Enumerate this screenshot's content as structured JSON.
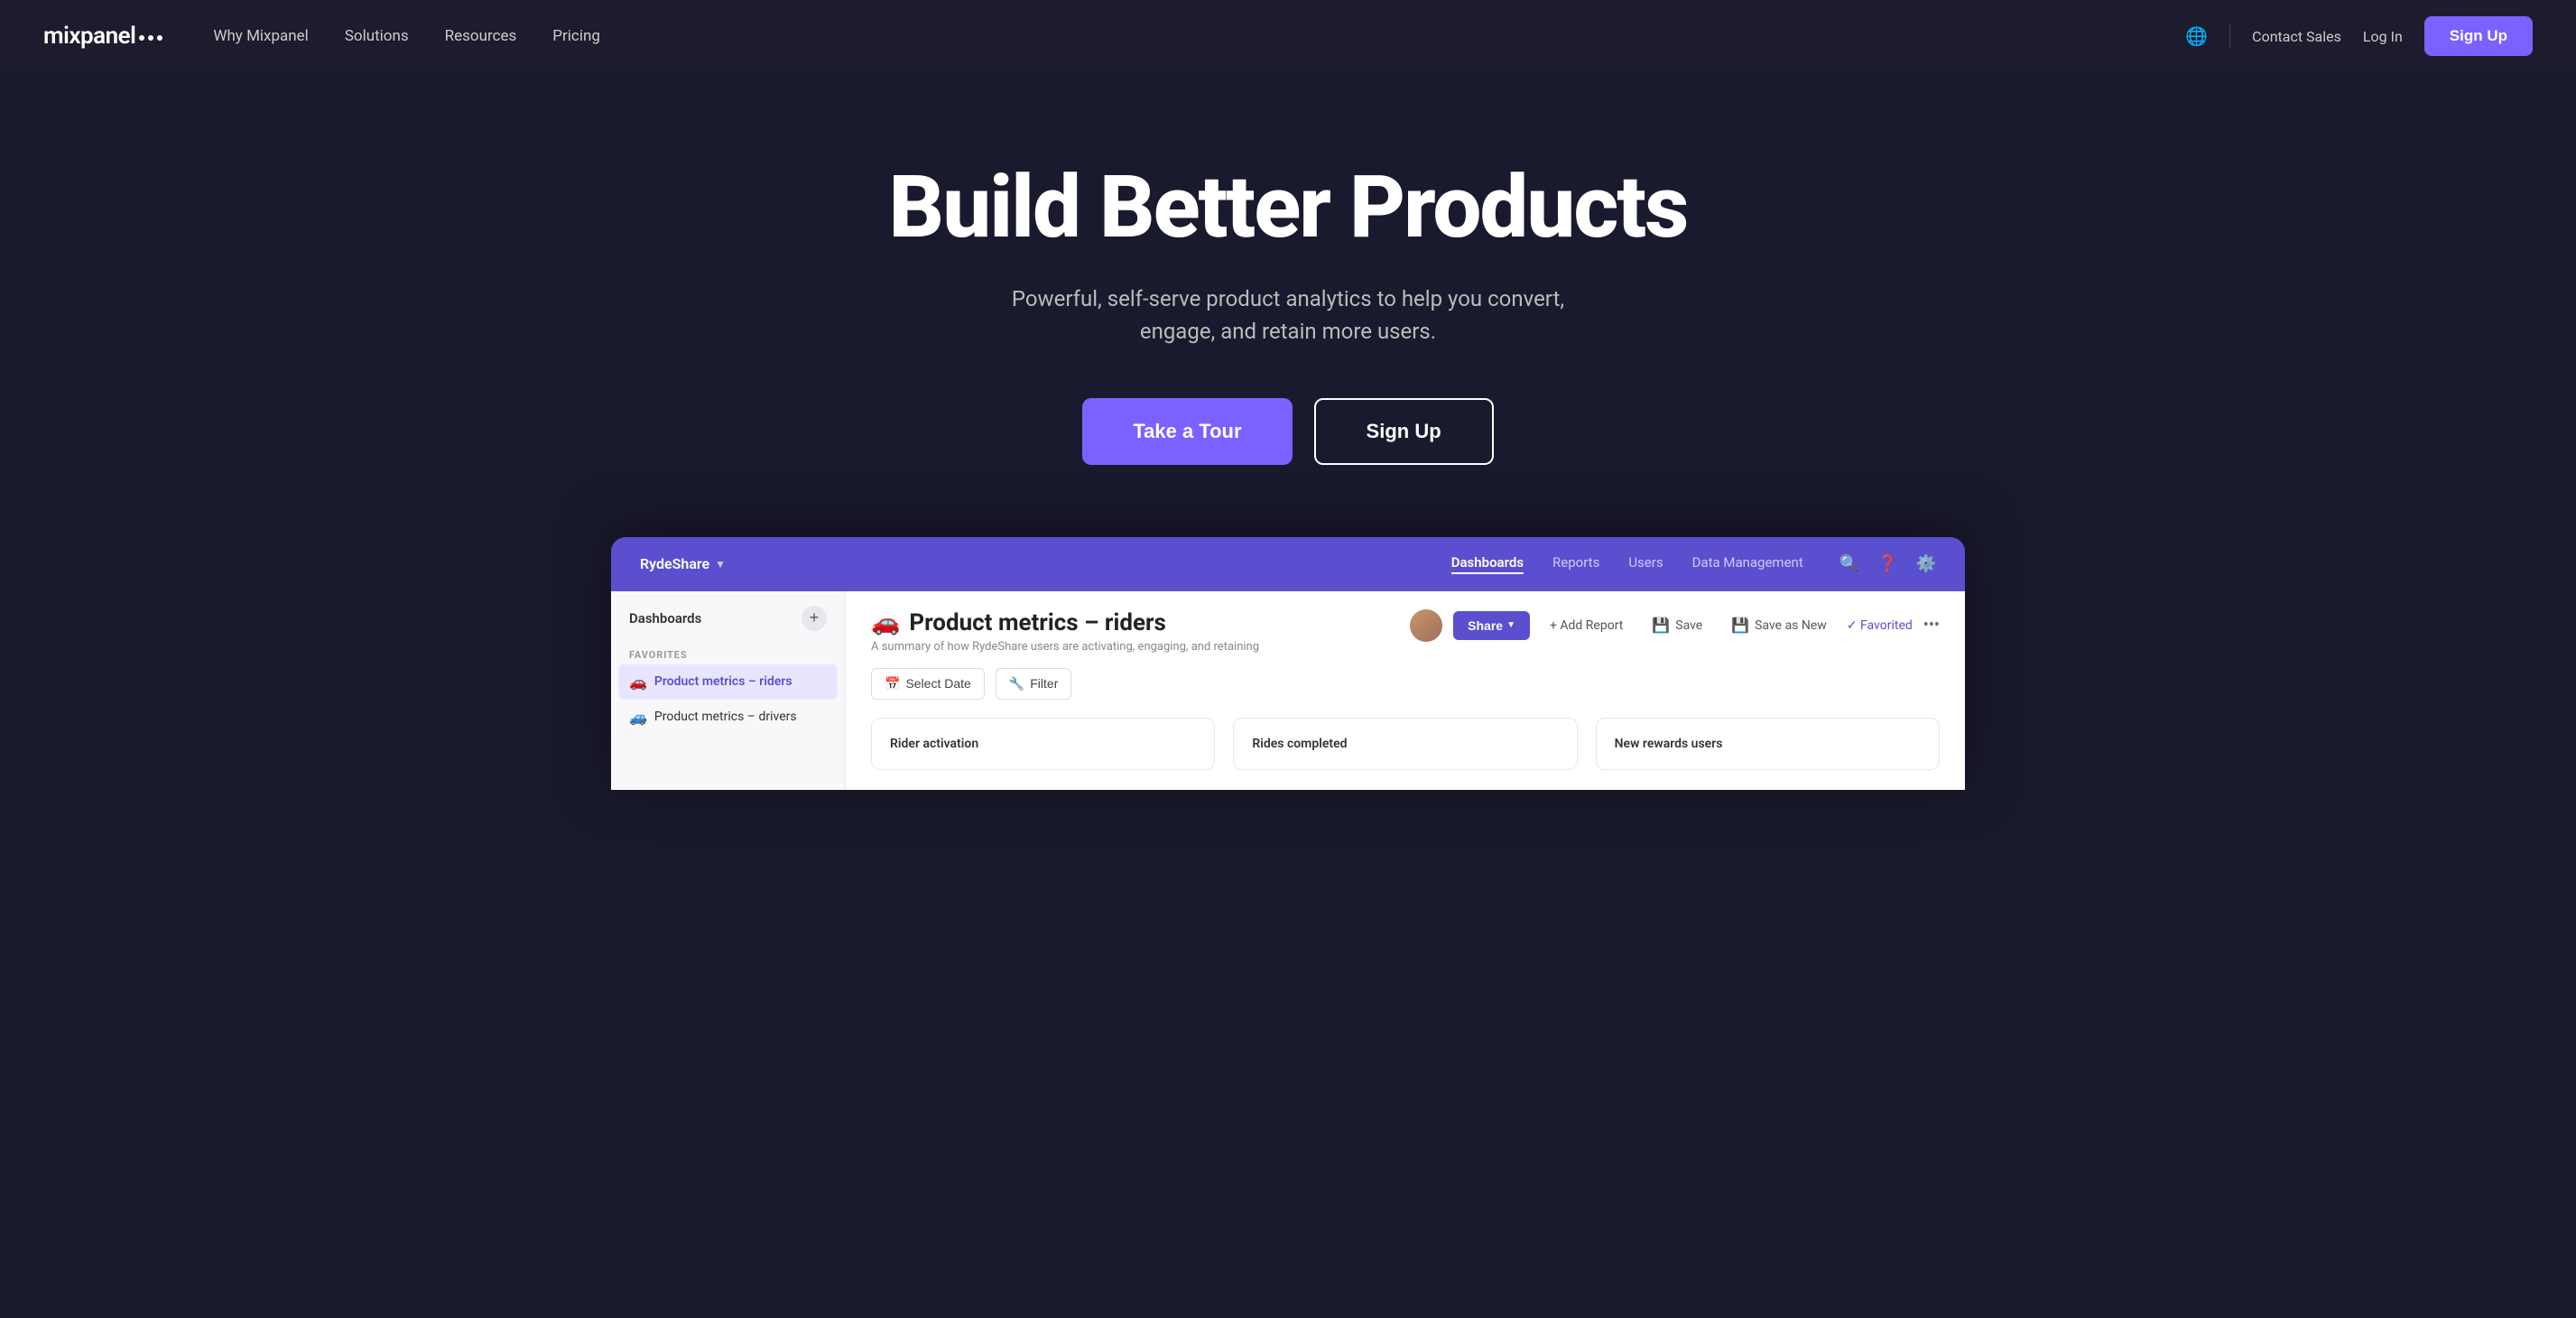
{
  "nav": {
    "logo_text": "mixpanel",
    "links": [
      {
        "label": "Why Mixpanel"
      },
      {
        "label": "Solutions"
      },
      {
        "label": "Resources"
      },
      {
        "label": "Pricing"
      }
    ],
    "contact_sales": "Contact Sales",
    "log_in": "Log In",
    "sign_up": "Sign Up"
  },
  "hero": {
    "title": "Build Better Products",
    "subtitle": "Powerful, self-serve product analytics to help you convert, engage, and retain more users.",
    "btn_tour": "Take a Tour",
    "btn_signup": "Sign Up"
  },
  "app": {
    "org_name": "RydeShare",
    "topbar_tabs": [
      {
        "label": "Dashboards",
        "active": true
      },
      {
        "label": "Reports",
        "active": false
      },
      {
        "label": "Users",
        "active": false
      },
      {
        "label": "Data Management",
        "active": false
      }
    ],
    "topbar_icons": [
      "search",
      "help",
      "settings"
    ],
    "sidebar": {
      "header": "Dashboards",
      "section_label": "FAVORITES",
      "items": [
        {
          "label": "Product metrics – riders",
          "icon": "🚗",
          "active": true
        },
        {
          "label": "Product metrics – drivers",
          "icon": "🚙",
          "active": false
        }
      ]
    },
    "dashboard": {
      "title": "Product metrics – riders",
      "icon": "🚗",
      "subtitle": "A summary of how RydeShare users are activating, engaging, and retaining",
      "share_label": "Share",
      "add_report_label": "+ Add Report",
      "save_label": "Save",
      "save_as_new_label": "Save as New",
      "favorited_label": "✓ Favorited",
      "select_date_label": "Select Date",
      "filter_label": "Filter",
      "metric_cards": [
        {
          "title": "Rider activation"
        },
        {
          "title": "Rides completed"
        },
        {
          "title": "New rewards users"
        }
      ]
    }
  }
}
